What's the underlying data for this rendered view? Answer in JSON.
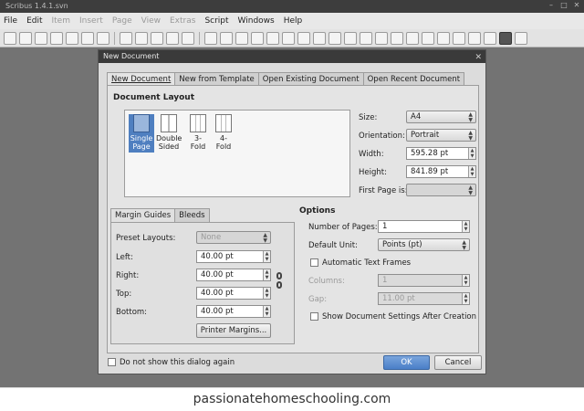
{
  "app": {
    "title": "Scribus 1.4.1.svn",
    "menu": [
      "File",
      "Edit",
      "Item",
      "Insert",
      "Page",
      "View",
      "Extras",
      "Script",
      "Windows",
      "Help"
    ]
  },
  "dialog": {
    "title": "New Document",
    "close": "✕",
    "tabs": [
      "New Document",
      "New from Template",
      "Open Existing Document",
      "Open Recent Document"
    ],
    "layout_title": "Document Layout",
    "layouts": [
      {
        "line1": "Single",
        "line2": "Page"
      },
      {
        "line1": "Double",
        "line2": "Sided"
      },
      {
        "line1": "3-",
        "line2": "Fold"
      },
      {
        "line1": "4-",
        "line2": "Fold"
      }
    ],
    "size_label": "Size:",
    "size_value": "A4",
    "orientation_label": "Orientation:",
    "orientation_value": "Portrait",
    "width_label": "Width:",
    "width_value": "595.28 pt",
    "height_label": "Height:",
    "height_value": "841.89 pt",
    "first_page_label": "First Page is:",
    "margin_tabs": [
      "Margin Guides",
      "Bleeds"
    ],
    "preset_label": "Preset Layouts:",
    "preset_value": "None",
    "left_label": "Left:",
    "left_value": "40.00 pt",
    "right_label": "Right:",
    "right_value": "40.00 pt",
    "top_label": "Top:",
    "top_value": "40.00 pt",
    "bottom_label": "Bottom:",
    "bottom_value": "40.00 pt",
    "printer_margins": "Printer Margins...",
    "options_title": "Options",
    "num_pages_label": "Number of Pages:",
    "num_pages_value": "1",
    "default_unit_label": "Default Unit:",
    "default_unit_value": "Points (pt)",
    "auto_frames_label": "Automatic Text Frames",
    "columns_label": "Columns:",
    "columns_value": "1",
    "gap_label": "Gap:",
    "gap_value": "11.00 pt",
    "show_settings_label": "Show Document Settings After Creation",
    "dont_show_label": "Do not show this dialog again",
    "ok": "OK",
    "cancel": "Cancel"
  },
  "footer": {
    "text": "passionatehomeschooling.com"
  }
}
